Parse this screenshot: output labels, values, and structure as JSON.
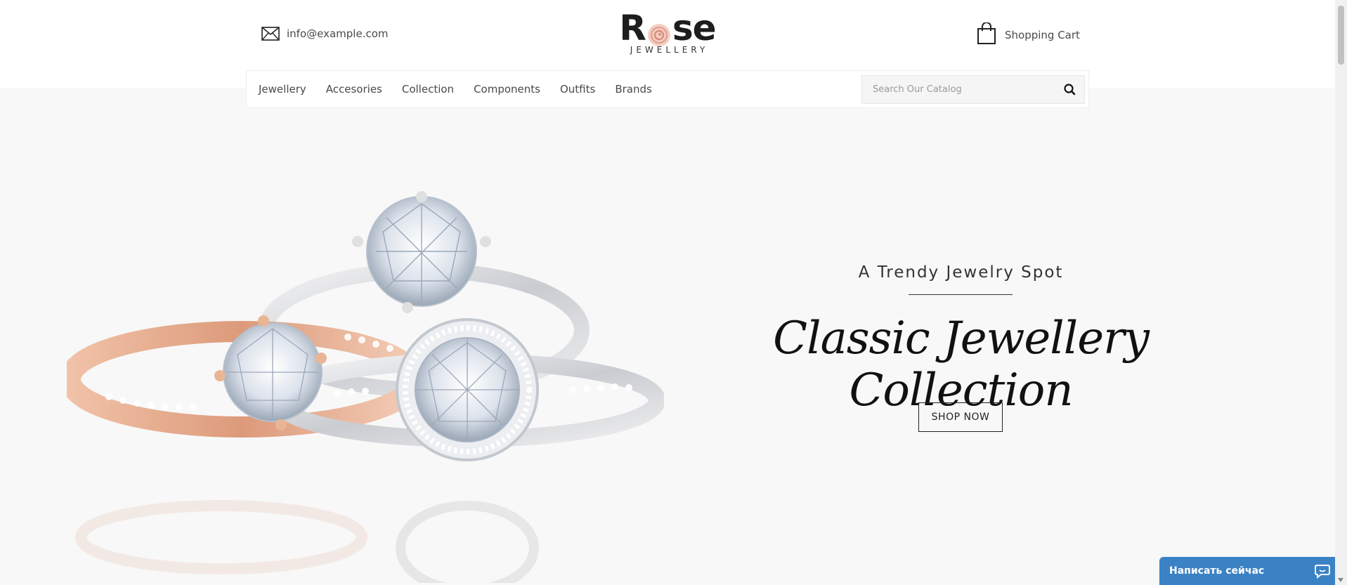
{
  "header": {
    "email": "info@example.com",
    "email_icon": "envelope-icon",
    "logo": {
      "main_before": "R",
      "main_after": "se",
      "sub": "JEWELLERY"
    },
    "cart_label": "Shopping Cart",
    "cart_icon": "shopping-bag-icon"
  },
  "nav": {
    "items": [
      {
        "label": "Jewellery"
      },
      {
        "label": "Accesories"
      },
      {
        "label": "Collection"
      },
      {
        "label": "Components"
      },
      {
        "label": "Outfits"
      },
      {
        "label": "Brands"
      }
    ],
    "search": {
      "placeholder": "Search Our Catalog",
      "icon": "search-icon"
    }
  },
  "hero": {
    "subtitle": "A Trendy Jewelry Spot",
    "title": "Classic Jewellery Collection",
    "button": "SHOP NOW"
  },
  "chat": {
    "label": "Написать сейчас",
    "icon": "chat-bubble-icon"
  },
  "colors": {
    "hero_background": "#f8f8f8",
    "chat_background": "#3b82c4",
    "logo_rose": "#e8b4a6",
    "rose_gold": "#e3a88c"
  }
}
